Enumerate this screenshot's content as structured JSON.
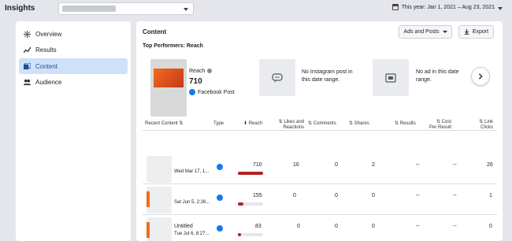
{
  "header": {
    "brand": "Insights",
    "date_range": "This year: Jan 1, 2021 – Aug 23, 2021"
  },
  "sidebar": {
    "items": [
      {
        "label": "Overview",
        "icon": "overview-icon",
        "active": false
      },
      {
        "label": "Results",
        "icon": "results-icon",
        "active": false
      },
      {
        "label": "Content",
        "icon": "content-icon",
        "active": true
      },
      {
        "label": "Audience",
        "icon": "audience-icon",
        "active": false
      }
    ]
  },
  "main": {
    "title": "Content",
    "ads_button": "Ads and Posts",
    "export_button": "Export",
    "top_performers_label": "Top Performers: Reach",
    "top_post": {
      "metric": "Reach",
      "value": "710",
      "source": "Facebook Post"
    },
    "instagram_empty": "No Instagram post in this date range.",
    "ad_empty": "No ad in this date range."
  },
  "table": {
    "headers": {
      "recent": "Recent Content",
      "type": "Type",
      "reach": "Reach",
      "likes": "Likes and Reactions",
      "comments": "Comments",
      "shares": "Shares",
      "results": "Results",
      "cost": "Cost Per Result",
      "link_clicks": "Link Clicks"
    },
    "rows": [
      {
        "title": "",
        "date": "Wed Mar 17, 1...",
        "reach": "710",
        "reach_fraction": 1.0,
        "likes": "16",
        "comments": "0",
        "shares": "2",
        "results": "--",
        "cost": "--",
        "link_clicks": "26"
      },
      {
        "title": "",
        "date": "Sat Jun 5, 2:26...",
        "reach": "155",
        "reach_fraction": 0.22,
        "likes": "0",
        "comments": "0",
        "shares": "0",
        "results": "--",
        "cost": "--",
        "link_clicks": "1"
      },
      {
        "title": "Untitled",
        "date": "Tue Jul 6, 8:27...",
        "reach": "83",
        "reach_fraction": 0.12,
        "likes": "0",
        "comments": "0",
        "shares": "0",
        "results": "--",
        "cost": "--",
        "link_clicks": "0"
      }
    ]
  },
  "colors": {
    "accent": "#1877f2",
    "active_nav": "#cfe1f7",
    "reach_bar": "#b52120"
  }
}
